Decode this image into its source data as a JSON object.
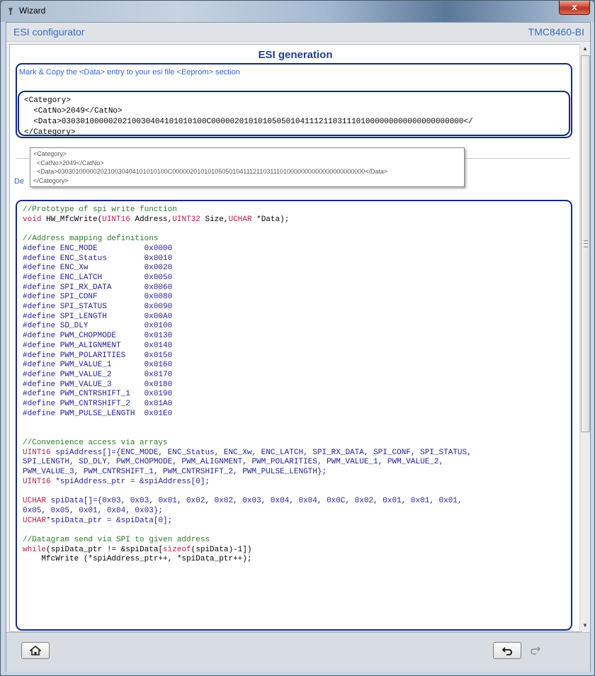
{
  "window": {
    "title": "Wizard",
    "close_label": "x"
  },
  "header": {
    "left": "ESI configurator",
    "right": "TMC8460-BI"
  },
  "section": {
    "title": "ESI generation",
    "instruction": "Mark & Copy  the <Data> entry to your esi file <Eeprom> section",
    "xml": "<Category>\n  <CatNo>2049</CatNo>\n  <Data>0303010000020210030404101010100C000002010101050501041112110311101000000000000000000000</\n</Category>",
    "tooltip": "<Category>\n  <CatNo>2049</CatNo>\n  <Data>0303010000020210030404101010100C0000020101010505010411121103111010000000000000000000000</Data>\n</Category>",
    "label_de": "De"
  },
  "code": {
    "proto_comment": "//Prototype of spi write function",
    "proto_void": "void",
    "proto_fn": " HW_MfcWrite(",
    "proto_t1": "UINT16",
    "proto_a1": " Address,",
    "proto_t2": "UINT32",
    "proto_a2": " Size,",
    "proto_t3": "UCHAR",
    "proto_a3": " *Data);",
    "defines_comment": "//Address mapping definitions",
    "defines": "#define ENC_MODE          0x0000\n#define ENC_Status        0x0010\n#define ENC_Xw            0x0020\n#define ENC_LATCH         0x0050\n#define SPI_RX_DATA       0x0060\n#define SPI_CONF          0x0080\n#define SPI_STATUS        0x0090\n#define SPI_LENGTH        0x00A0\n#define SD_DLY            0x0100\n#define PWM_CHOPMODE      0x0130\n#define PWM_ALIGNMENT     0x0140\n#define PWM_POLARITIES    0x0150\n#define PWM_VALUE_1       0x0160\n#define PWM_VALUE_2       0x0170\n#define PWM_VALUE_3       0x0180\n#define PWM_CNTRSHIFT_1   0x0190\n#define PWM_CNTRSHIFT_2   0x01A0\n#define PWM_PULSE_LENGTH  0x01E0",
    "arrays_comment": "//Convenience access via arrays",
    "addr_type": "UINT16",
    "addr_body": " spiAddress[]={ENC_MODE, ENC_Status, ENC_Xw, ENC_LATCH, SPI_RX_DATA, SPI_CONF, SPI_STATUS,\nSPI_LENGTH, SD_DLY, PWM_CHOPMODE, PWM_ALIGNMENT, PWM_POLARITIES, PWM_VALUE_1, PWM_VALUE_2,\nPWM_VALUE_3, PWM_CNTRSHIFT_1, PWM_CNTRSHIFT_2, PWM_PULSE_LENGTH};",
    "addr_ptr_type": "UINT16",
    "addr_ptr_body": " *spiAddress_ptr = &spiAddress[0];",
    "data_type": "UCHAR",
    "data_body": " spiData[]={0x03, 0x03, 0x01, 0x02, 0x02, 0x03, 0x04, 0x04, 0x0C, 0x02, 0x01, 0x01, 0x01,\n0x05, 0x05, 0x01, 0x04, 0x03};",
    "data_ptr_type": "UCHAR",
    "data_ptr_body": "*spiData_ptr = &spiData[0];",
    "send_comment": "//Datagram send via SPI to given address",
    "while_kw": "while",
    "while_body1": "(spiData_ptr != &spiData[",
    "sizeof_kw": "sizeof",
    "while_body2": "(spiData)-1])",
    "write_line": "    MfcWrite (*spiAddress_ptr++, *spiData_ptr++);"
  },
  "icons": {
    "home": "home-icon",
    "undo": "undo-icon",
    "redo": "redo-icon"
  }
}
